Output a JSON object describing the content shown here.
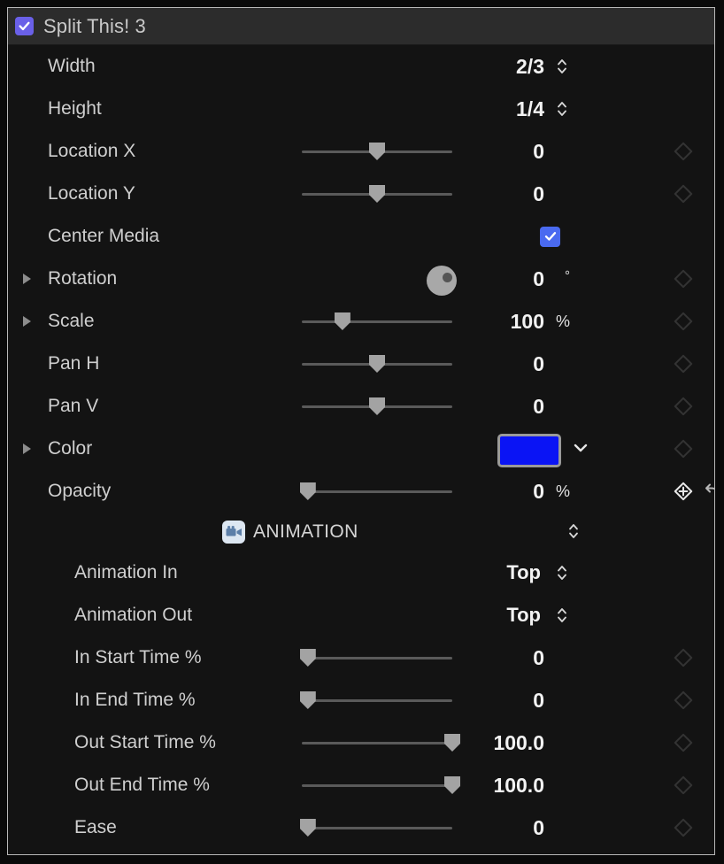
{
  "panel": {
    "title": "Split This! 3",
    "enabled_checkbox": "checked",
    "accent_checkbox_color": "#6a60e8",
    "border_color": "#b9b9b9",
    "header_bg": "#2c2c2c"
  },
  "rows": [
    {
      "label": "Width",
      "control": "stepper",
      "value": "2/3",
      "unit": "",
      "keyframe": false
    },
    {
      "label": "Height",
      "control": "stepper",
      "value": "1/4",
      "unit": "",
      "keyframe": false
    },
    {
      "label": "Location X",
      "control": "slider",
      "value": "0",
      "unit": "",
      "slider_pct": 50,
      "keyframe": true
    },
    {
      "label": "Location Y",
      "control": "slider",
      "value": "0",
      "unit": "",
      "slider_pct": 50,
      "keyframe": true
    },
    {
      "label": "Center Media",
      "control": "checkbox",
      "value": "checked",
      "unit": "",
      "keyframe": false
    },
    {
      "label": "Rotation",
      "control": "dial",
      "value": "0",
      "unit": "°",
      "twisty": true,
      "keyframe": true
    },
    {
      "label": "Scale",
      "control": "slider",
      "value": "100",
      "unit": "%",
      "slider_pct": 27,
      "twisty": true,
      "keyframe": true
    },
    {
      "label": "Pan H",
      "control": "slider",
      "value": "0",
      "unit": "",
      "slider_pct": 50,
      "keyframe": true
    },
    {
      "label": "Pan V",
      "control": "slider",
      "value": "0",
      "unit": "",
      "slider_pct": 50,
      "keyframe": true
    },
    {
      "label": "Color",
      "control": "swatch",
      "value": "#0a14f5",
      "unit": "",
      "twisty": true,
      "keyframe": true
    },
    {
      "label": "Opacity",
      "control": "slider",
      "value": "0",
      "unit": "%",
      "slider_pct": 4,
      "keyframe_active": true,
      "reset": true
    }
  ],
  "animation_section": {
    "icon": "movie-camera-icon",
    "title": "ANIMATION",
    "stepper": "up-down-stepper"
  },
  "animation_rows": [
    {
      "label": "Animation In",
      "control": "stepper",
      "value": "Top",
      "unit": "",
      "keyframe": false
    },
    {
      "label": "Animation Out",
      "control": "stepper",
      "value": "Top",
      "unit": "",
      "keyframe": false
    },
    {
      "label": "In Start Time %",
      "control": "slider",
      "value": "0",
      "unit": "",
      "slider_pct": 4,
      "keyframe": true
    },
    {
      "label": "In End Time %",
      "control": "slider",
      "value": "0",
      "unit": "",
      "slider_pct": 4,
      "keyframe": true
    },
    {
      "label": "Out Start Time %",
      "control": "slider",
      "value": "100.0",
      "unit": "",
      "slider_pct": 100,
      "keyframe": true
    },
    {
      "label": "Out End Time %",
      "control": "slider",
      "value": "100.0",
      "unit": "",
      "slider_pct": 100,
      "keyframe": true
    },
    {
      "label": "Ease",
      "control": "slider",
      "value": "0",
      "unit": "",
      "slider_pct": 4,
      "keyframe": true
    }
  ]
}
